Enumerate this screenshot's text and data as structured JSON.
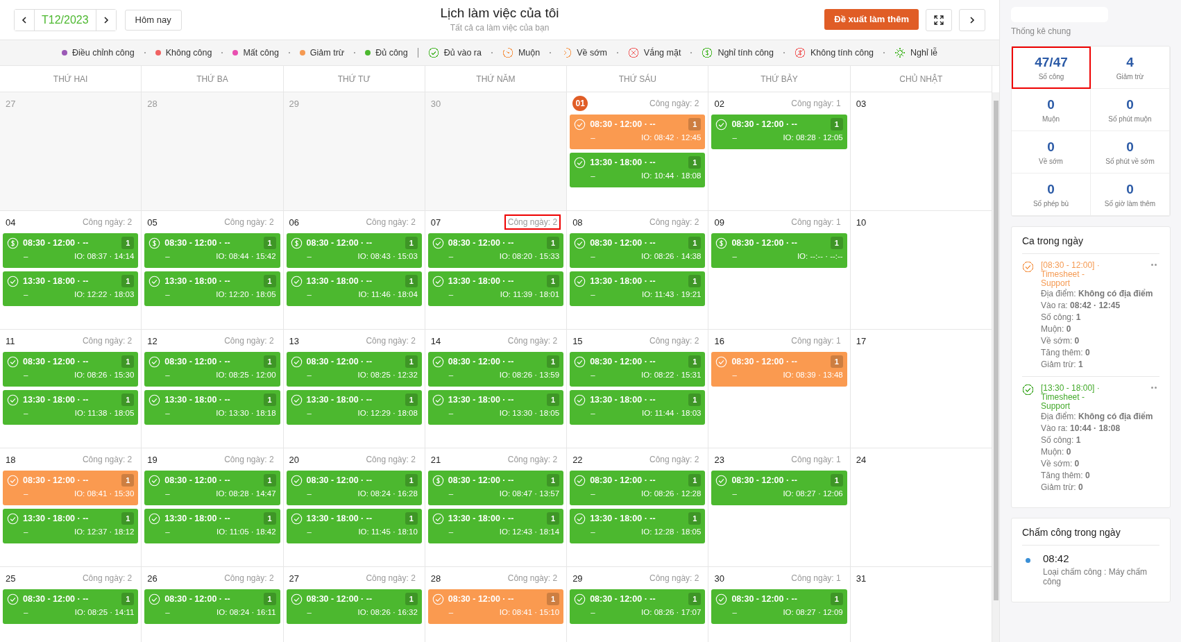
{
  "header": {
    "month": "T12/2023",
    "today_button": "Hôm nay",
    "title": "Lịch làm việc của tôi",
    "subtitle": "Tất cả ca làm việc của bạn",
    "propose_button": "Đề xuất làm thêm"
  },
  "legend_status": [
    {
      "color": "#9b59b6",
      "label": "Điều chỉnh công"
    },
    {
      "color": "#f06262",
      "label": "Không công"
    },
    {
      "color": "#e84fb0",
      "label": "Mất công"
    },
    {
      "color": "#f59a52",
      "label": "Giảm trừ"
    },
    {
      "color": "#4cb82f",
      "label": "Đủ công"
    }
  ],
  "legend_icons": [
    {
      "kind": "check",
      "color": "#4cb82f",
      "label": "Đủ vào ra"
    },
    {
      "kind": "late",
      "color": "#f59a52",
      "label": "Muộn"
    },
    {
      "kind": "early",
      "color": "#f59a52",
      "label": "Về sớm"
    },
    {
      "kind": "absent",
      "color": "#f06262",
      "label": "Vắng mặt"
    },
    {
      "kind": "dollar",
      "color": "#4cb82f",
      "label": "Nghỉ tính công"
    },
    {
      "kind": "dollar-off",
      "color": "#f06262",
      "label": "Không tính công"
    },
    {
      "kind": "sun",
      "color": "#4cb82f",
      "label": "Nghỉ lễ"
    }
  ],
  "weekdays": [
    "THỨ HAI",
    "THỨ BA",
    "THỨ TƯ",
    "THỨ NĂM",
    "THỨ SÁU",
    "THỨ BẢY",
    "CHỦ NHẬT"
  ],
  "weeks": [
    [
      {
        "day": "27",
        "outside": true
      },
      {
        "day": "28",
        "outside": true
      },
      {
        "day": "29",
        "outside": true
      },
      {
        "day": "30",
        "outside": true
      },
      {
        "day": "01",
        "outside": false,
        "today": true,
        "workday": "Công ngày: 2",
        "shifts": [
          {
            "color": "#fa9a50",
            "kind": "check",
            "time": "08:30 - 12:00 · --",
            "count": "1",
            "note": "–",
            "io": "IO: 08:42 · 12:45"
          },
          {
            "color": "#4cb82f",
            "kind": "check",
            "time": "13:30 - 18:00 · --",
            "count": "1",
            "note": "–",
            "io": "IO: 10:44 · 18:08"
          }
        ]
      },
      {
        "day": "02",
        "outside": false,
        "workday": "Công ngày: 1",
        "shifts": [
          {
            "color": "#4cb82f",
            "kind": "check",
            "time": "08:30 - 12:00 · --",
            "count": "1",
            "note": "–",
            "io": "IO: 08:28 · 12:05"
          }
        ]
      },
      {
        "day": "03",
        "outside": false
      }
    ],
    [
      {
        "day": "04",
        "outside": false,
        "workday": "Công ngày: 2",
        "shifts": [
          {
            "color": "#4cb82f",
            "kind": "dollar",
            "time": "08:30 - 12:00 · --",
            "count": "1",
            "note": "–",
            "io": "IO: 08:37 · 14:14"
          },
          {
            "color": "#4cb82f",
            "kind": "check",
            "time": "13:30 - 18:00 · --",
            "count": "1",
            "note": "–",
            "io": "IO: 12:22 · 18:03"
          }
        ]
      },
      {
        "day": "05",
        "outside": false,
        "workday": "Công ngày: 2",
        "shifts": [
          {
            "color": "#4cb82f",
            "kind": "dollar",
            "time": "08:30 - 12:00 · --",
            "count": "1",
            "note": "–",
            "io": "IO: 08:44 · 15:42"
          },
          {
            "color": "#4cb82f",
            "kind": "check",
            "time": "13:30 - 18:00 · --",
            "count": "1",
            "note": "–",
            "io": "IO: 12:20 · 18:05"
          }
        ]
      },
      {
        "day": "06",
        "outside": false,
        "workday": "Công ngày: 2",
        "shifts": [
          {
            "color": "#4cb82f",
            "kind": "dollar",
            "time": "08:30 - 12:00 · --",
            "count": "1",
            "note": "–",
            "io": "IO: 08:43 · 15:03"
          },
          {
            "color": "#4cb82f",
            "kind": "check",
            "time": "13:30 - 18:00 · --",
            "count": "1",
            "note": "–",
            "io": "IO: 11:46 · 18:04"
          }
        ]
      },
      {
        "day": "07",
        "outside": false,
        "workday": "Công ngày: 2",
        "workday_highlighted": true,
        "shifts": [
          {
            "color": "#4cb82f",
            "kind": "check",
            "time": "08:30 - 12:00 · --",
            "count": "1",
            "note": "–",
            "io": "IO: 08:20 · 15:33"
          },
          {
            "color": "#4cb82f",
            "kind": "check",
            "time": "13:30 - 18:00 · --",
            "count": "1",
            "note": "–",
            "io": "IO: 11:39 · 18:01"
          }
        ]
      },
      {
        "day": "08",
        "outside": false,
        "workday": "Công ngày: 2",
        "shifts": [
          {
            "color": "#4cb82f",
            "kind": "check",
            "time": "08:30 - 12:00 · --",
            "count": "1",
            "note": "–",
            "io": "IO: 08:26 · 14:38"
          },
          {
            "color": "#4cb82f",
            "kind": "check",
            "time": "13:30 - 18:00 · --",
            "count": "1",
            "note": "–",
            "io": "IO: 11:43 · 19:21"
          }
        ]
      },
      {
        "day": "09",
        "outside": false,
        "workday": "Công ngày: 1",
        "shifts": [
          {
            "color": "#4cb82f",
            "kind": "dollar",
            "time": "08:30 - 12:00 · --",
            "count": "1",
            "note": "–",
            "io": "IO: --:-- · --:--"
          }
        ]
      },
      {
        "day": "10",
        "outside": false
      }
    ],
    [
      {
        "day": "11",
        "outside": false,
        "workday": "Công ngày: 2",
        "shifts": [
          {
            "color": "#4cb82f",
            "kind": "check",
            "time": "08:30 - 12:00 · --",
            "count": "1",
            "note": "–",
            "io": "IO: 08:26 · 15:30"
          },
          {
            "color": "#4cb82f",
            "kind": "check",
            "time": "13:30 - 18:00 · --",
            "count": "1",
            "note": "–",
            "io": "IO: 11:38 · 18:05"
          }
        ]
      },
      {
        "day": "12",
        "outside": false,
        "workday": "Công ngày: 2",
        "shifts": [
          {
            "color": "#4cb82f",
            "kind": "check",
            "time": "08:30 - 12:00 · --",
            "count": "1",
            "note": "–",
            "io": "IO: 08:25 · 12:00"
          },
          {
            "color": "#4cb82f",
            "kind": "check",
            "time": "13:30 - 18:00 · --",
            "count": "1",
            "note": "–",
            "io": "IO: 13:30 · 18:18"
          }
        ]
      },
      {
        "day": "13",
        "outside": false,
        "workday": "Công ngày: 2",
        "shifts": [
          {
            "color": "#4cb82f",
            "kind": "check",
            "time": "08:30 - 12:00 · --",
            "count": "1",
            "note": "–",
            "io": "IO: 08:25 · 12:32"
          },
          {
            "color": "#4cb82f",
            "kind": "check",
            "time": "13:30 - 18:00 · --",
            "count": "1",
            "note": "–",
            "io": "IO: 12:29 · 18:08"
          }
        ]
      },
      {
        "day": "14",
        "outside": false,
        "workday": "Công ngày: 2",
        "shifts": [
          {
            "color": "#4cb82f",
            "kind": "check",
            "time": "08:30 - 12:00 · --",
            "count": "1",
            "note": "–",
            "io": "IO: 08:26 · 13:59"
          },
          {
            "color": "#4cb82f",
            "kind": "check",
            "time": "13:30 - 18:00 · --",
            "count": "1",
            "note": "–",
            "io": "IO: 13:30 · 18:05"
          }
        ]
      },
      {
        "day": "15",
        "outside": false,
        "workday": "Công ngày: 2",
        "shifts": [
          {
            "color": "#4cb82f",
            "kind": "check",
            "time": "08:30 - 12:00 · --",
            "count": "1",
            "note": "–",
            "io": "IO: 08:22 · 15:31"
          },
          {
            "color": "#4cb82f",
            "kind": "check",
            "time": "13:30 - 18:00 · --",
            "count": "1",
            "note": "–",
            "io": "IO: 11:44 · 18:03"
          }
        ]
      },
      {
        "day": "16",
        "outside": false,
        "workday": "Công ngày: 1",
        "shifts": [
          {
            "color": "#fa9a50",
            "kind": "check",
            "time": "08:30 - 12:00 · --",
            "count": "1",
            "note": "–",
            "io": "IO: 08:39 · 13:48"
          }
        ]
      },
      {
        "day": "17",
        "outside": false
      }
    ],
    [
      {
        "day": "18",
        "outside": false,
        "workday": "Công ngày: 2",
        "shifts": [
          {
            "color": "#fa9a50",
            "kind": "check",
            "time": "08:30 - 12:00 · --",
            "count": "1",
            "note": "–",
            "io": "IO: 08:41 · 15:30"
          },
          {
            "color": "#4cb82f",
            "kind": "check",
            "time": "13:30 - 18:00 · --",
            "count": "1",
            "note": "–",
            "io": "IO: 12:37 · 18:12"
          }
        ]
      },
      {
        "day": "19",
        "outside": false,
        "workday": "Công ngày: 2",
        "shifts": [
          {
            "color": "#4cb82f",
            "kind": "check",
            "time": "08:30 - 12:00 · --",
            "count": "1",
            "note": "–",
            "io": "IO: 08:28 · 14:47"
          },
          {
            "color": "#4cb82f",
            "kind": "check",
            "time": "13:30 - 18:00 · --",
            "count": "1",
            "note": "–",
            "io": "IO: 11:05 · 18:42"
          }
        ]
      },
      {
        "day": "20",
        "outside": false,
        "workday": "Công ngày: 2",
        "shifts": [
          {
            "color": "#4cb82f",
            "kind": "check",
            "time": "08:30 - 12:00 · --",
            "count": "1",
            "note": "–",
            "io": "IO: 08:24 · 16:28"
          },
          {
            "color": "#4cb82f",
            "kind": "check",
            "time": "13:30 - 18:00 · --",
            "count": "1",
            "note": "–",
            "io": "IO: 11:45 · 18:10"
          }
        ]
      },
      {
        "day": "21",
        "outside": false,
        "workday": "Công ngày: 2",
        "shifts": [
          {
            "color": "#4cb82f",
            "kind": "dollar",
            "time": "08:30 - 12:00 · --",
            "count": "1",
            "note": "–",
            "io": "IO: 08:47 · 13:57"
          },
          {
            "color": "#4cb82f",
            "kind": "check",
            "time": "13:30 - 18:00 · --",
            "count": "1",
            "note": "–",
            "io": "IO: 12:43 · 18:14"
          }
        ]
      },
      {
        "day": "22",
        "outside": false,
        "workday": "Công ngày: 2",
        "shifts": [
          {
            "color": "#4cb82f",
            "kind": "check",
            "time": "08:30 - 12:00 · --",
            "count": "1",
            "note": "–",
            "io": "IO: 08:26 · 12:28"
          },
          {
            "color": "#4cb82f",
            "kind": "check",
            "time": "13:30 - 18:00 · --",
            "count": "1",
            "note": "–",
            "io": "IO: 12:28 · 18:05"
          }
        ]
      },
      {
        "day": "23",
        "outside": false,
        "workday": "Công ngày: 1",
        "shifts": [
          {
            "color": "#4cb82f",
            "kind": "check",
            "time": "08:30 - 12:00 · --",
            "count": "1",
            "note": "–",
            "io": "IO: 08:27 · 12:06"
          }
        ]
      },
      {
        "day": "24",
        "outside": false
      }
    ],
    [
      {
        "day": "25",
        "outside": false,
        "workday": "Công ngày: 2",
        "shifts": [
          {
            "color": "#4cb82f",
            "kind": "check",
            "time": "08:30 - 12:00 · --",
            "count": "1",
            "note": "–",
            "io": "IO: 08:25 · 14:11"
          }
        ]
      },
      {
        "day": "26",
        "outside": false,
        "workday": "Công ngày: 2",
        "shifts": [
          {
            "color": "#4cb82f",
            "kind": "check",
            "time": "08:30 - 12:00 · --",
            "count": "1",
            "note": "–",
            "io": "IO: 08:24 · 16:11"
          }
        ]
      },
      {
        "day": "27",
        "outside": false,
        "workday": "Công ngày: 2",
        "shifts": [
          {
            "color": "#4cb82f",
            "kind": "check",
            "time": "08:30 - 12:00 · --",
            "count": "1",
            "note": "–",
            "io": "IO: 08:26 · 16:32"
          }
        ]
      },
      {
        "day": "28",
        "outside": false,
        "workday": "Công ngày: 2",
        "shifts": [
          {
            "color": "#fa9a50",
            "kind": "check",
            "time": "08:30 - 12:00 · --",
            "count": "1",
            "note": "–",
            "io": "IO: 08:41 · 15:10"
          }
        ]
      },
      {
        "day": "29",
        "outside": false,
        "workday": "Công ngày: 2",
        "shifts": [
          {
            "color": "#4cb82f",
            "kind": "check",
            "time": "08:30 - 12:00 · --",
            "count": "1",
            "note": "–",
            "io": "IO: 08:26 · 17:07"
          }
        ]
      },
      {
        "day": "30",
        "outside": false,
        "workday": "Công ngày: 1",
        "shifts": [
          {
            "color": "#4cb82f",
            "kind": "check",
            "time": "08:30 - 12:00 · --",
            "count": "1",
            "note": "–",
            "io": "IO: 08:27 · 12:09"
          }
        ]
      },
      {
        "day": "31",
        "outside": false
      }
    ]
  ],
  "stats": {
    "title": "Thống kê chung",
    "items": [
      {
        "value": "47/47",
        "label": "Số công",
        "highlighted": true
      },
      {
        "value": "4",
        "label": "Giảm trừ",
        "highlighted": false
      },
      {
        "value": "0",
        "label": "Muộn",
        "highlighted": false
      },
      {
        "value": "0",
        "label": "Số phút muộn",
        "highlighted": false
      },
      {
        "value": "0",
        "label": "Về sớm",
        "highlighted": false
      },
      {
        "value": "0",
        "label": "Số phút về sớm",
        "highlighted": false
      },
      {
        "value": "0",
        "label": "Số phép bù",
        "highlighted": false
      },
      {
        "value": "0",
        "label": "Số giờ làm thêm",
        "highlighted": false
      }
    ]
  },
  "shifts_panel": {
    "title": "Ca trong ngày",
    "items": [
      {
        "color": "#f59a52",
        "title": "[08:30 - 12:00] · Timesheet - Support",
        "details": [
          "Địa điểm: **Không có địa điểm**",
          "Vào ra: **08:42 · 12:45**",
          "Số công: **1**",
          "Muộn: **0**",
          "Về sớm: **0**",
          "Tăng thêm: **0**",
          "Giảm trừ: **1**"
        ]
      },
      {
        "color": "#43a92a",
        "title": "[13:30 - 18:00] · Timesheet - Support",
        "details": [
          "Địa điểm: **Không có địa điểm**",
          "Vào ra: **10:44 · 18:08**",
          "Số công: **1**",
          "Muộn: **0**",
          "Về sớm: **0**",
          "Tăng thêm: **0**",
          "Giảm trừ: **0**"
        ]
      }
    ]
  },
  "punch_panel": {
    "title": "Chấm công trong ngày",
    "items": [
      {
        "time": "08:42",
        "detail": "Loại chấm công : Máy chấm công"
      }
    ]
  }
}
